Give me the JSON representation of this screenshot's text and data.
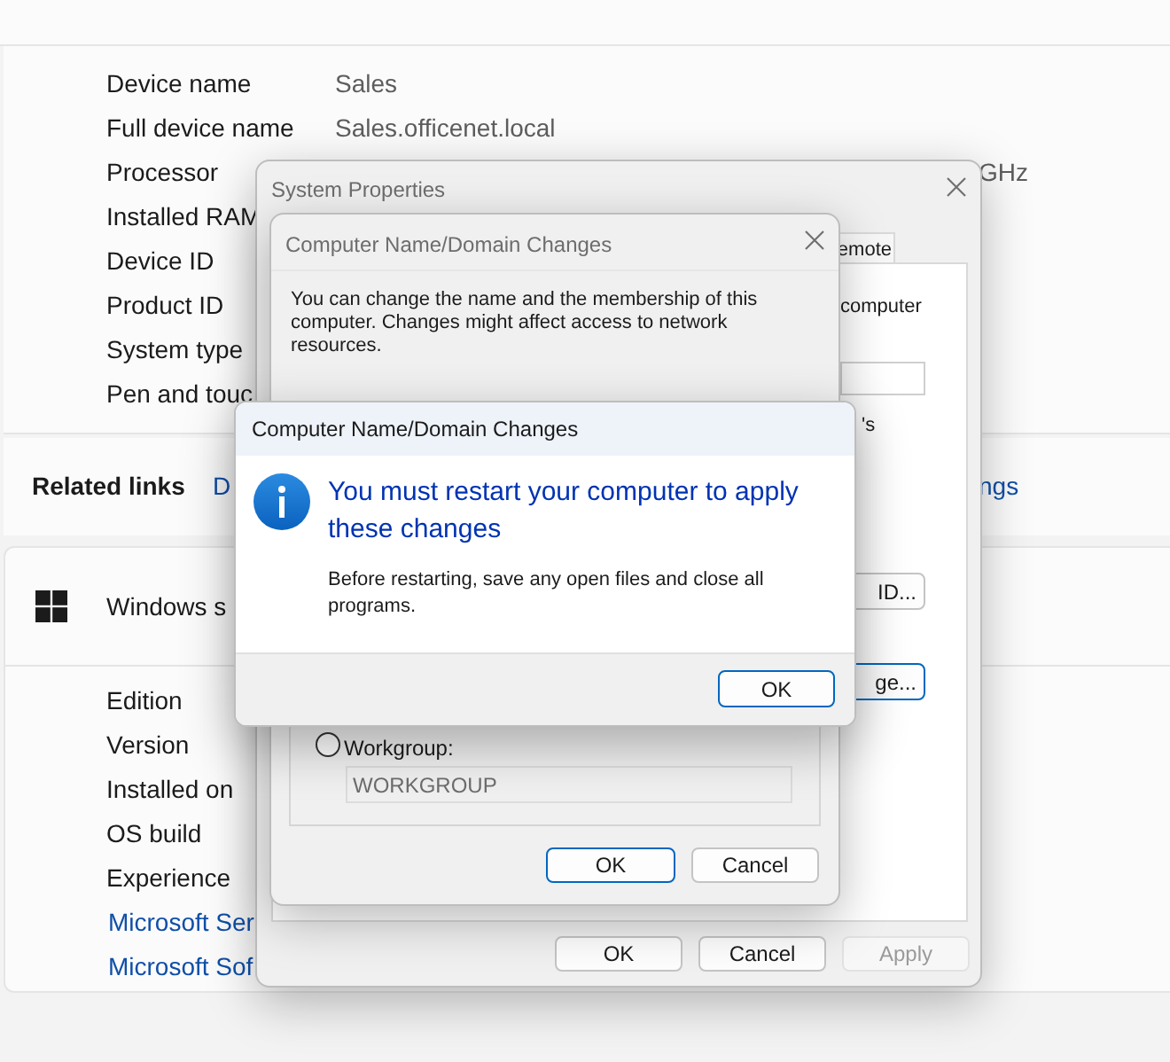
{
  "settings": {
    "device_specifications": [
      {
        "label": "Device name",
        "value": "Sales"
      },
      {
        "label": "Full device name",
        "value": "Sales.officenet.local"
      },
      {
        "label": "Processor",
        "value_tail": "GHz"
      },
      {
        "label": "Installed RAM"
      },
      {
        "label": "Device ID"
      },
      {
        "label": "Product ID"
      },
      {
        "label": "System type"
      },
      {
        "label": "Pen and touc"
      }
    ],
    "related_links": {
      "label": "Related links",
      "links": [
        "D",
        "ngs"
      ]
    },
    "windows_specifications": {
      "title": "Windows s",
      "rows": [
        "Edition",
        "Version",
        "Installed on",
        "OS build",
        "Experience"
      ],
      "links": [
        "Microsoft Ser",
        "Microsoft Sof"
      ]
    }
  },
  "system_properties": {
    "title": "System Properties",
    "tabs": [
      {
        "label": "emote",
        "selected": false
      }
    ],
    "texts": [
      "computer",
      "'s"
    ],
    "side_buttons": [
      {
        "label": "ID...",
        "default": false
      },
      {
        "label": "ge...",
        "default": true
      }
    ],
    "buttons": [
      {
        "label": "OK",
        "disabled": false
      },
      {
        "label": "Cancel",
        "disabled": false
      },
      {
        "label": "Apply",
        "disabled": true
      }
    ]
  },
  "computer_name_changes": {
    "title": "Computer Name/Domain Changes",
    "description": "You can change the name and the membership of this computer. Changes might affect access to network resources.",
    "workgroup": {
      "label": "Workgroup:",
      "selected": false,
      "value": "WORKGROUP",
      "disabled": true
    },
    "buttons": [
      {
        "label": "OK",
        "default": true
      },
      {
        "label": "Cancel",
        "default": false
      }
    ]
  },
  "restart_dialog": {
    "title": "Computer Name/Domain Changes",
    "heading": "You must restart your computer to apply these changes",
    "message": "Before restarting, save any open files and close all programs.",
    "buttons": [
      {
        "label": "OK",
        "default": true
      }
    ]
  }
}
